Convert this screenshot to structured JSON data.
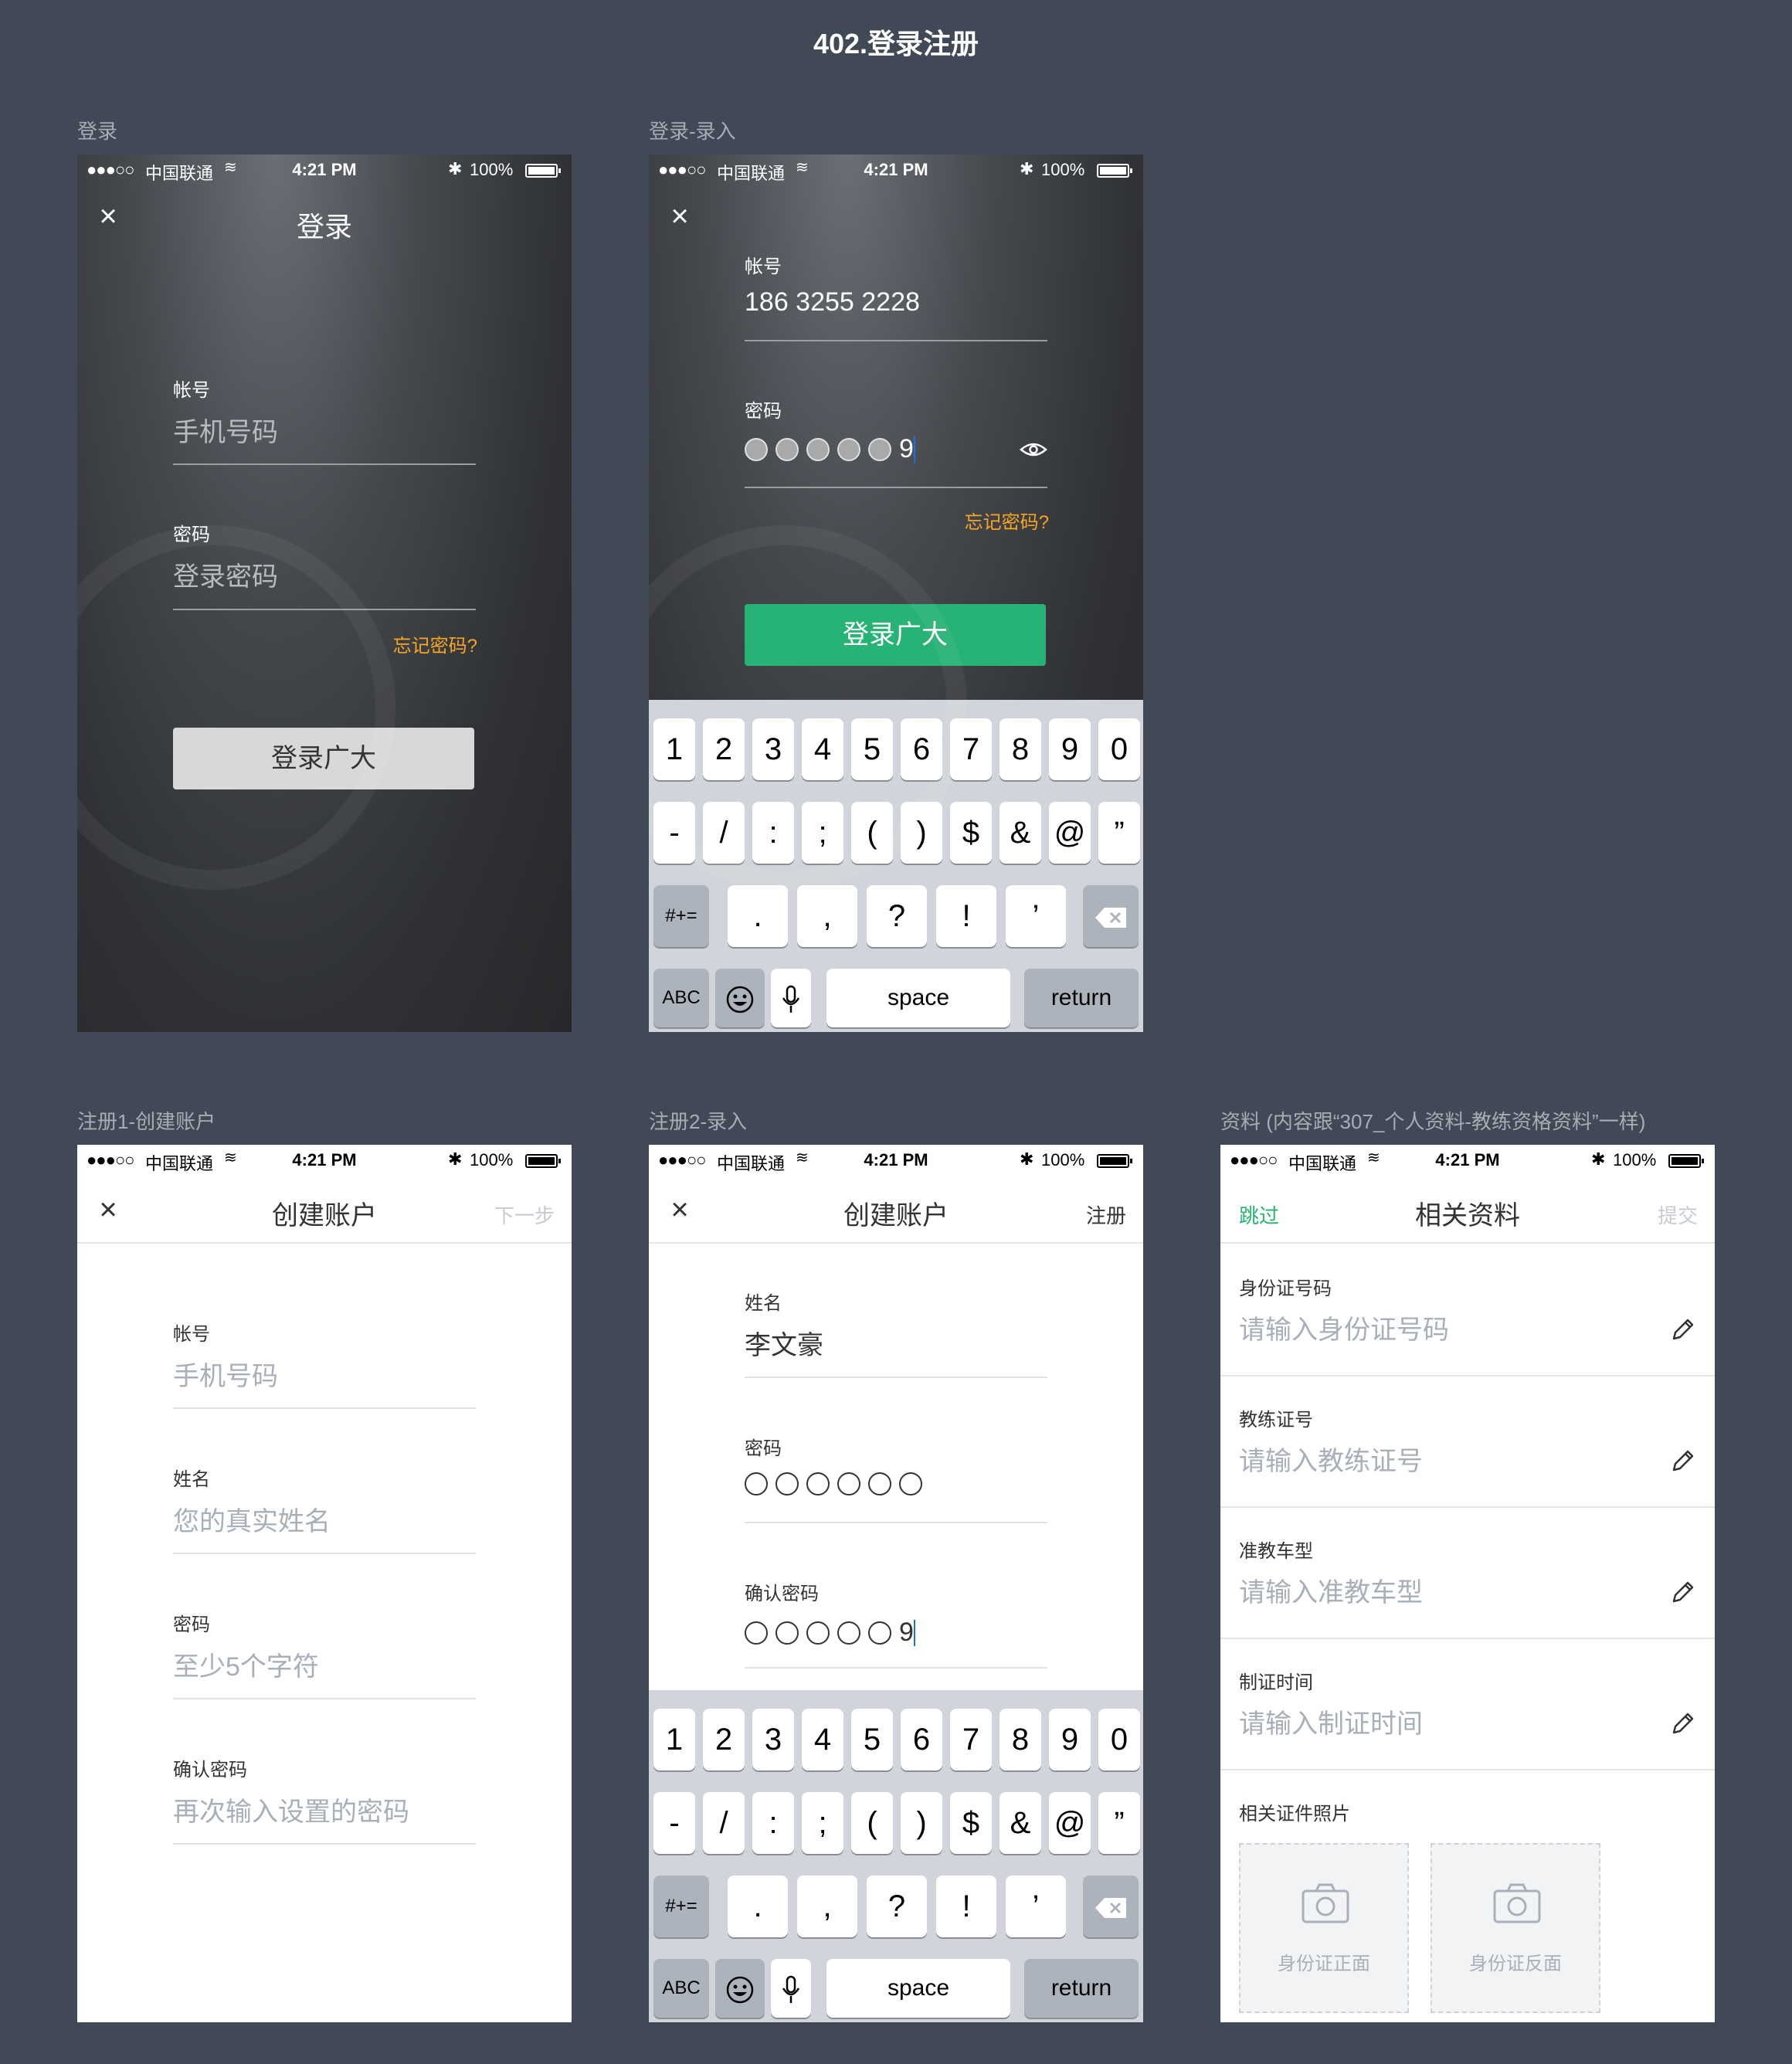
{
  "page_title": "402.登录注册",
  "status_bar": {
    "signal": "●●●○○",
    "carrier": "中国联通",
    "wifi": "≋",
    "time": "4:21 PM",
    "bluetooth": "✱",
    "battery": "100%"
  },
  "screens": {
    "login": {
      "label": "登录",
      "nav_title": "登录",
      "close": "×",
      "account_label": "帐号",
      "account_placeholder": "手机号码",
      "password_label": "密码",
      "password_placeholder": "登录密码",
      "forgot": "忘记密码?",
      "submit": "登录广大"
    },
    "login_input": {
      "label": "登录-录入",
      "close": "×",
      "account_label": "帐号",
      "account_value": "186 3255 2228",
      "password_label": "密码",
      "password_tail": "9",
      "forgot": "忘记密码?",
      "submit": "登录广大"
    },
    "register1": {
      "label": "注册1-创建账户",
      "close": "×",
      "nav_title": "创建账户",
      "nav_right": "下一步",
      "fields": [
        {
          "label": "帐号",
          "placeholder": "手机号码"
        },
        {
          "label": "姓名",
          "placeholder": "您的真实姓名"
        },
        {
          "label": "密码",
          "placeholder": "至少5个字符"
        },
        {
          "label": "确认密码",
          "placeholder": "再次输入设置的密码"
        }
      ]
    },
    "register2": {
      "label": "注册2-录入",
      "close": "×",
      "nav_title": "创建账户",
      "nav_right": "注册",
      "name_label": "姓名",
      "name_value": "李文豪",
      "password_label": "密码",
      "confirm_label": "确认密码",
      "confirm_tail": "9"
    },
    "profile": {
      "label": "资料 (内容跟“307_个人资料-教练资格资料”一样)",
      "nav_left": "跳过",
      "nav_title": "相关资料",
      "nav_right": "提交",
      "fields": [
        {
          "label": "身份证号码",
          "placeholder": "请输入身份证号码"
        },
        {
          "label": "教练证号",
          "placeholder": "请输入教练证号"
        },
        {
          "label": "准教车型",
          "placeholder": "请输入准教车型"
        },
        {
          "label": "制证时间",
          "placeholder": "请输入制证时间"
        }
      ],
      "photos_label": "相关证件照片",
      "photo_front": "身份证正面",
      "photo_back": "身份证反面"
    }
  },
  "keyboard": {
    "row1": [
      "1",
      "2",
      "3",
      "4",
      "5",
      "6",
      "7",
      "8",
      "9",
      "0"
    ],
    "row2": [
      "-",
      "/",
      ":",
      ";",
      "(",
      ")",
      "$",
      "&",
      "@",
      "”"
    ],
    "row3_left": "#+=",
    "row3": [
      ".",
      ",",
      "?",
      "!",
      "’"
    ],
    "abc": "ABC",
    "space": "space",
    "return": "return"
  },
  "colors": {
    "background": "#414956",
    "green": "#27b375",
    "orange": "#f5a623",
    "placeholder": "#a9afb9"
  }
}
